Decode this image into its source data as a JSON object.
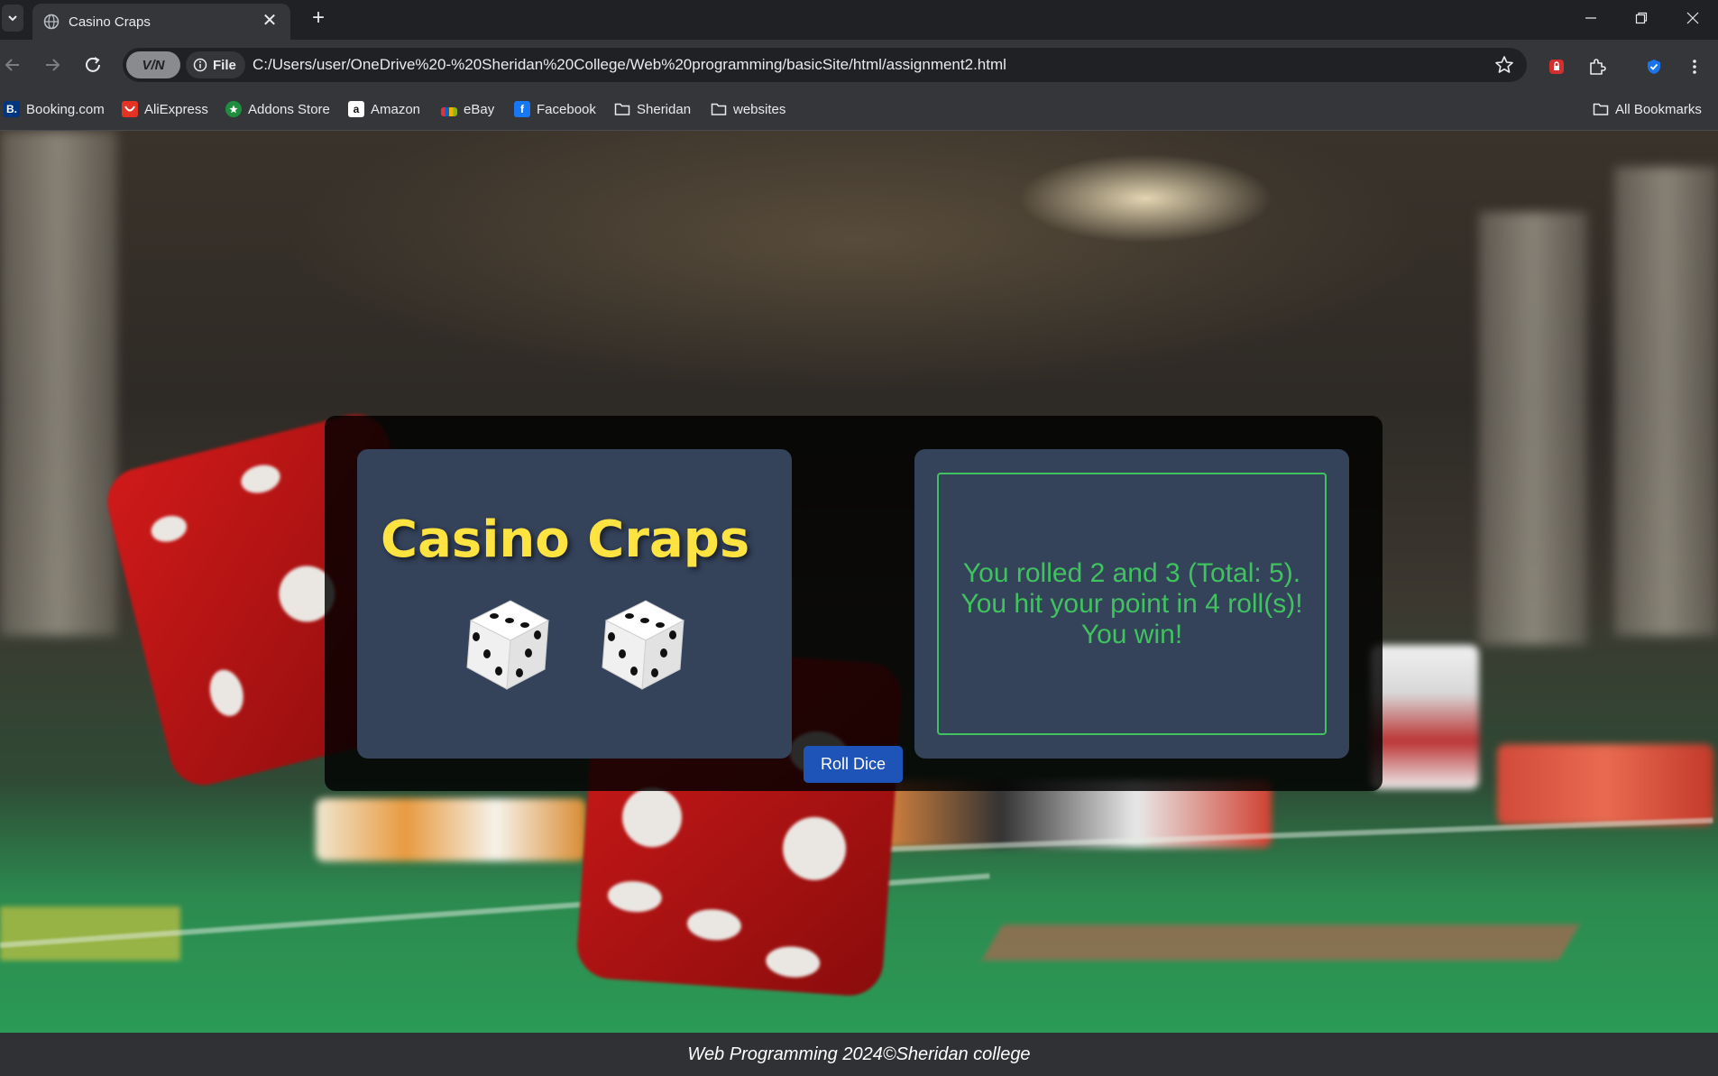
{
  "browser": {
    "tab": {
      "title": "Casino Craps",
      "favicon": "globe-icon"
    },
    "toolbar": {
      "vpn_label": "V/N",
      "file_label": "File",
      "url": "C:/Users/user/OneDrive%20-%20Sheridan%20College/Web%20programming/basicSite/html/assignment2.html"
    },
    "bookmarks": [
      {
        "label": "Booking.com",
        "icon": "booking-icon",
        "icon_text": "B.",
        "color": "#003580"
      },
      {
        "label": "AliExpress",
        "icon": "aliexpress-icon",
        "icon_text": "",
        "color": "#e43225"
      },
      {
        "label": "Addons Store",
        "icon": "addons-store-icon",
        "icon_text": "",
        "color": "#1e8e3e"
      },
      {
        "label": "Amazon",
        "icon": "amazon-icon",
        "icon_text": "a",
        "color": "#ffffff"
      },
      {
        "label": "eBay",
        "icon": "ebay-icon",
        "icon_text": "",
        "color": "#e53238"
      },
      {
        "label": "Facebook",
        "icon": "facebook-icon",
        "icon_text": "f",
        "color": "#1877f2"
      },
      {
        "label": "Sheridan",
        "icon": "folder-icon",
        "icon_text": "",
        "color": ""
      },
      {
        "label": "websites",
        "icon": "folder-icon",
        "icon_text": "",
        "color": ""
      }
    ],
    "all_bookmarks_label": "All Bookmarks"
  },
  "page": {
    "title": "Casino Craps",
    "dice": [
      3,
      3
    ],
    "roll_button_label": "Roll Dice",
    "result_lines": [
      "You rolled 2 and 3 (Total: 5).",
      "You hit your point in 4 roll(s)!",
      "You win!"
    ],
    "footer": "Web Programming 2024©Sheridan college"
  },
  "colors": {
    "title_yellow": "#ffe441",
    "result_green": "#3fc35f",
    "card_bg": "#34425a",
    "button_blue": "#1e53b8"
  }
}
